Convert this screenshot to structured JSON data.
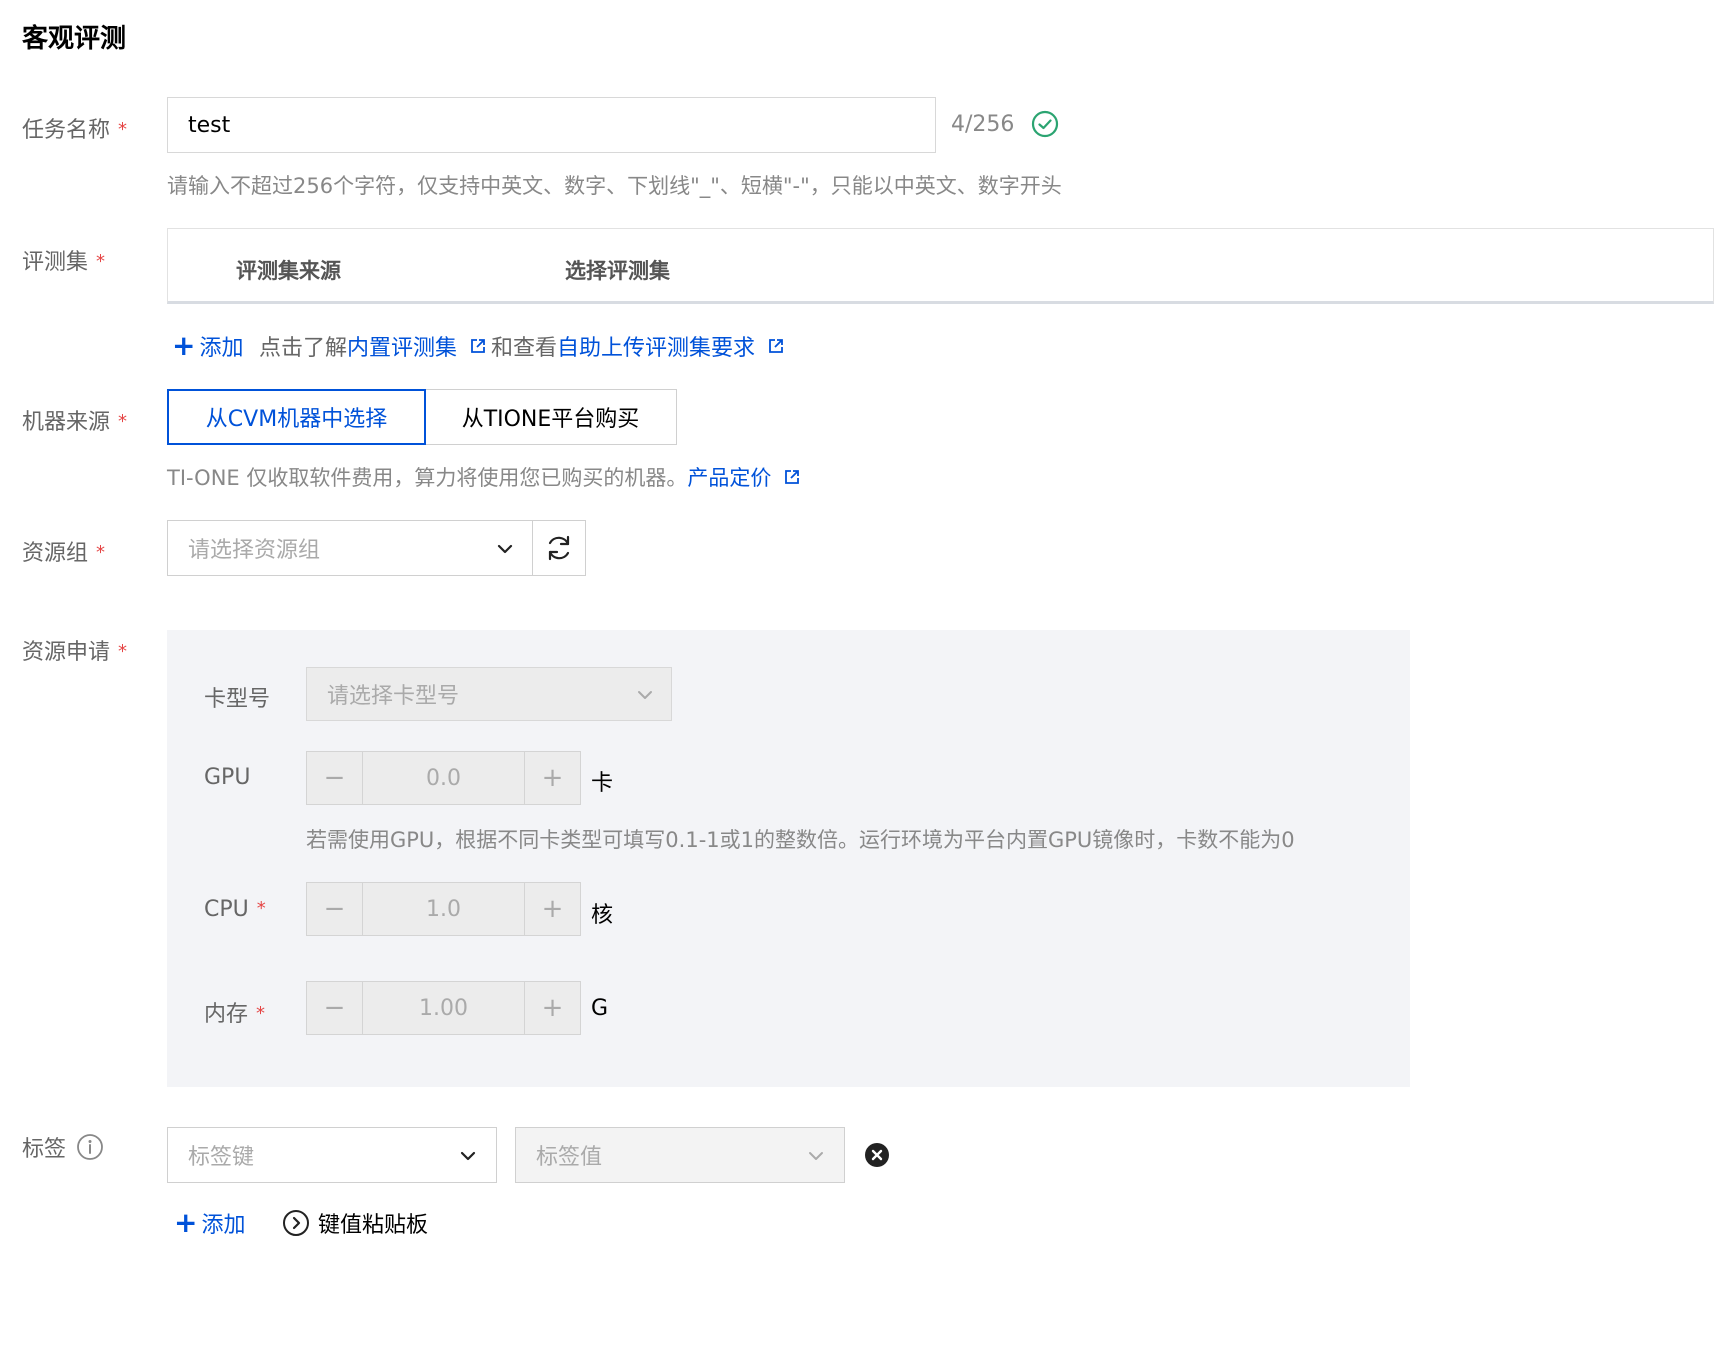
{
  "page": {
    "title": "客观评测"
  },
  "task_name": {
    "label": "任务名称",
    "required_mark": "*",
    "value": "test",
    "counter": "4/256",
    "hint": "请输入不超过256个字符，仅支持中英文、数字、下划线\"_\"、短横\"-\"，只能以中英文、数字开头"
  },
  "eval_set": {
    "label": "评测集",
    "required_mark": "*",
    "columns": [
      "评测集来源",
      "选择评测集"
    ],
    "add_label": "添加",
    "info_prefix": "点击了解",
    "builtin_link": "内置评测集",
    "info_middle": "和查看",
    "upload_link": "自助上传评测集要求"
  },
  "machine_source": {
    "label": "机器来源",
    "required_mark": "*",
    "options": [
      "从CVM机器中选择",
      "从TIONE平台购买"
    ],
    "selected": "从CVM机器中选择",
    "hint": "TI-ONE 仅收取软件费用，算力将使用您已购买的机器。",
    "pricing_link": "产品定价"
  },
  "resource_group": {
    "label": "资源组",
    "required_mark": "*",
    "placeholder": "请选择资源组"
  },
  "resource_request": {
    "label": "资源申请",
    "required_mark": "*",
    "card_type": {
      "label": "卡型号",
      "placeholder": "请选择卡型号"
    },
    "gpu": {
      "label": "GPU",
      "value": "0.0",
      "unit": "卡",
      "hint": "若需使用GPU，根据不同卡类型可填写0.1-1或1的整数倍。运行环境为平台内置GPU镜像时，卡数不能为0"
    },
    "cpu": {
      "label": "CPU",
      "required_mark": "*",
      "value": "1.0",
      "unit": "核"
    },
    "memory": {
      "label": "内存",
      "required_mark": "*",
      "value": "1.00",
      "unit": "G"
    },
    "minus": "−",
    "plus": "+"
  },
  "tags": {
    "label": "标签",
    "key_placeholder": "标签键",
    "value_placeholder": "标签值",
    "add_label": "添加",
    "clipboard_label": "键值粘贴板"
  },
  "colors": {
    "primary": "#0052d9",
    "required": "#e54545",
    "success": "#2ba471"
  }
}
